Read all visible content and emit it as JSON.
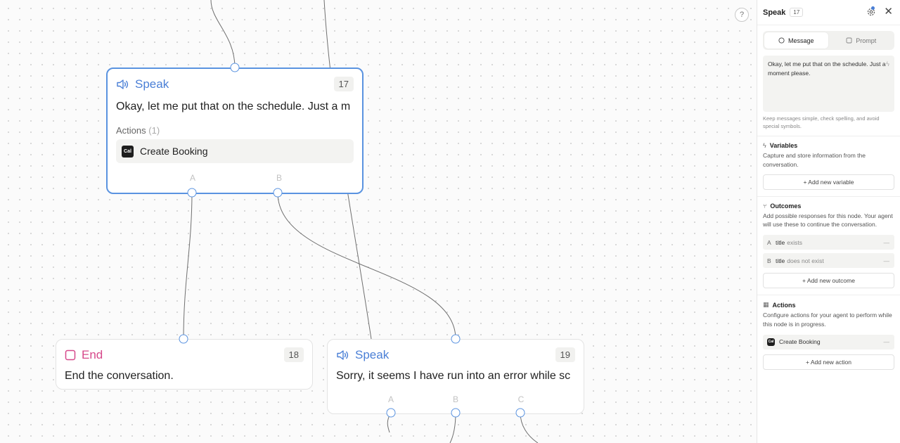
{
  "canvas": {
    "help_icon": "?",
    "nodes": [
      {
        "type": "speak",
        "title": "Speak",
        "count": "17",
        "message": "Okay, let me put that on the schedule. Just a m",
        "actions_label": "Actions",
        "actions_count": "(1)",
        "action": "Create Booking",
        "action_logo": "Cal",
        "outputs": [
          "A",
          "B"
        ]
      },
      {
        "type": "end",
        "title": "End",
        "count": "18",
        "message": "End the conversation."
      },
      {
        "type": "speak",
        "title": "Speak",
        "count": "19",
        "message": "Sorry, it seems I have run into an error while sc",
        "outputs": [
          "A",
          "B",
          "C"
        ]
      }
    ]
  },
  "panel": {
    "title": "Speak",
    "count": "17",
    "close_icon": "✕",
    "tabs": [
      {
        "label": "Message",
        "active": true
      },
      {
        "label": "Prompt",
        "active": false
      }
    ],
    "message": "Okay, let me put that on the schedule. Just a moment please.",
    "hint": "Keep messages simple, check spelling, and avoid special symbols.",
    "variables": {
      "title": "Variables",
      "description": "Capture and store information from the conversation.",
      "add_label": "+ Add new variable"
    },
    "outcomes": {
      "title": "Outcomes",
      "description": "Add possible responses for this node. Your agent will use these to continue the conversation.",
      "items": [
        {
          "letter": "A",
          "field": "title",
          "op": "exists"
        },
        {
          "letter": "B",
          "field": "title",
          "op": "does not exist"
        }
      ],
      "add_label": "+ Add new outcome"
    },
    "actions": {
      "title": "Actions",
      "description": "Configure actions for your agent to perform while this node is in progress.",
      "items": [
        {
          "label": "Create Booking",
          "logo": "Cal"
        }
      ],
      "add_label": "+ Add new action"
    }
  },
  "colors": {
    "accent": "#5a93e0",
    "speak": "#4a7fd6",
    "end": "#d6488a",
    "wire": "#6f6f6f"
  }
}
